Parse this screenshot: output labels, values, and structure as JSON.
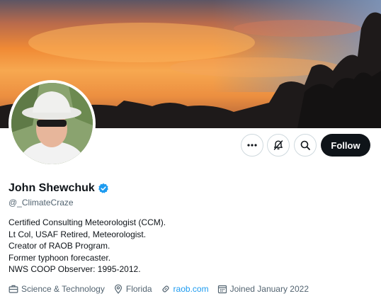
{
  "profile": {
    "name": "John Shewchuk",
    "handle": "@_ClimateCraze",
    "bio": [
      "Certified Consulting Meteorologist (CCM).",
      "Lt Col, USAF Retired, Meteorologist.",
      "Creator of RAOB Program.",
      "Former typhoon forecaster.",
      "NWS COOP Observer: 1995-2012."
    ],
    "category": "Science & Technology",
    "location": "Florida",
    "website": "raob.com",
    "joined": "Joined January 2022",
    "verified": true
  },
  "actions": {
    "more_icon": "more-icon",
    "notify_icon": "notifications-off-icon",
    "search_icon": "search-icon",
    "follow_label": "Follow"
  },
  "colors": {
    "accent": "#1d9bf0",
    "follow_bg": "#0f1419",
    "muted_text": "#536471"
  }
}
